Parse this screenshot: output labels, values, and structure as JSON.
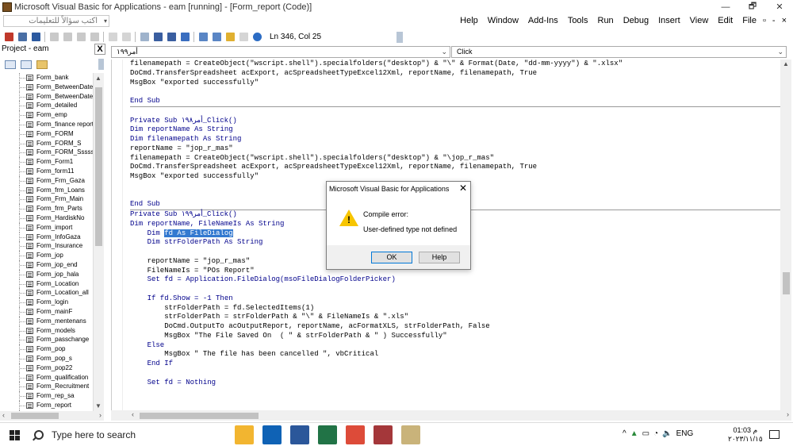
{
  "window": {
    "title": "Microsoft Visual Basic for Applications - eam [running] - [Form_report (Code)]",
    "controls": [
      "—",
      "🗗",
      "✕"
    ]
  },
  "menubar": {
    "help_box_placeholder": "اكتب سؤالاً للتعليمات",
    "items": [
      "Help",
      "Window",
      "Add-Ins",
      "Tools",
      "Run",
      "Debug",
      "Insert",
      "View",
      "Edit",
      "File"
    ],
    "mdi_controls": [
      "▫",
      "-",
      "×"
    ]
  },
  "toolbar": {
    "position": "Ln 346, Col 25"
  },
  "project": {
    "header": "Project - eam",
    "close": "X",
    "items": [
      "Form_bank",
      "Form_BetweenDate",
      "Form_BetweenDate2",
      "Form_detailed",
      "Form_emp",
      "Form_finance report",
      "Form_FORM",
      "Form_FORM_S",
      "Form_FORM_Ssssss",
      "Form_Form1",
      "Form_form11",
      "Form_Frm_Gaza",
      "Form_frm_Loans",
      "Form_Frm_Main",
      "Form_frm_Parts",
      "Form_HardiskNo",
      "Form_import",
      "Form_InfoGaza",
      "Form_Insurance",
      "Form_jop",
      "Form_jop_end",
      "Form_jop_hala",
      "Form_Location",
      "Form_Location_all",
      "Form_login",
      "Form_mainF",
      "Form_mentenans",
      "Form_models",
      "Form_passchange",
      "Form_pop",
      "Form_pop_s",
      "Form_pop22",
      "Form_qualification",
      "Form_Recruitment",
      "Form_rep_sa",
      "Form_report",
      "Form_..."
    ]
  },
  "code_window": {
    "object": "أمر١٩٩",
    "procedure": "Click",
    "lines": [
      "filenamepath = CreateObject(\"wscript.shell\").specialfolders(\"desktop\") & \"\\\" & Format(Date, \"dd-mm-yyyy\") & \".xlsx\"",
      "DoCmd.TransferSpreadsheet acExport, acSpreadsheetTypeExcel12Xml, reportName, filenamepath, True",
      "MsgBox \"exported successfully\"",
      "",
      "End Sub",
      "---",
      "",
      "Private Sub أمر١٩٨_Click()",
      "Dim reportName As String",
      "Dim filenamepath As String",
      "reportName = \"jop_r_mas\"",
      "filenamepath = CreateObject(\"wscript.shell\").specialfolders(\"desktop\") & \"\\jop_r_mas\"",
      "DoCmd.TransferSpreadsheet acExport, acSpreadsheetTypeExcel12Xml, reportName, filenamepath, True",
      "MsgBox \"exported successfully\"",
      "",
      "",
      "End Sub",
      "---",
      "Private Sub أمر١٩٩_Click()",
      "Dim reportName, FileNameIs As String",
      "    Dim fd As FileDialog",
      "    Dim strFolderPath As String",
      "",
      "    reportName = \"jop_r_mas\"",
      "    FileNameIs = \"POs Report\"",
      "    Set fd = Application.FileDialog(msoFileDialogFolderPicker)",
      "",
      "    If fd.Show = -1 Then",
      "        strFolderPath = fd.SelectedItems(1)",
      "        strFolderPath = strFolderPath & \"\\\" & FileNameIs & \".xls\"",
      "        DoCmd.OutputTo acOutputReport, reportName, acFormatXLS, strFolderPath, False",
      "        MsgBox \"The File Saved On  ( \" & strFolderPath & \" ) Successfully\"",
      "    Else",
      "        MsgBox \" The file has been cancelled \", vbCritical",
      "    End If",
      "",
      "    Set fd = Nothing"
    ],
    "selected_text": "fd As FileDialog"
  },
  "dialog": {
    "title": "Microsoft Visual Basic for Applications",
    "close": "✕",
    "message_title": "Compile error:",
    "message_body": "User-defined type not defined",
    "ok_label": "OK",
    "help_label": "Help"
  },
  "taskbar": {
    "search_placeholder": "Type here to search",
    "apps": [
      {
        "icon": "file-explorer-icon",
        "color": "#f2b530"
      },
      {
        "icon": "outlook-icon",
        "color": "#0f62b5"
      },
      {
        "icon": "word-icon",
        "color": "#2b579a"
      },
      {
        "icon": "excel-icon",
        "color": "#217346"
      },
      {
        "icon": "chrome-icon",
        "color": "#dd4b39"
      },
      {
        "icon": "access-icon",
        "color": "#a4373a"
      },
      {
        "icon": "vba-icon",
        "color": "#c9b37a"
      }
    ],
    "tray": [
      "^",
      "ENG"
    ],
    "time": "01:03 م",
    "date": "٢٠٢٣/١١/١٥"
  },
  "colors": {
    "keyword": "#00008b",
    "selection": "#3379d0",
    "warning": "#f7c500"
  }
}
